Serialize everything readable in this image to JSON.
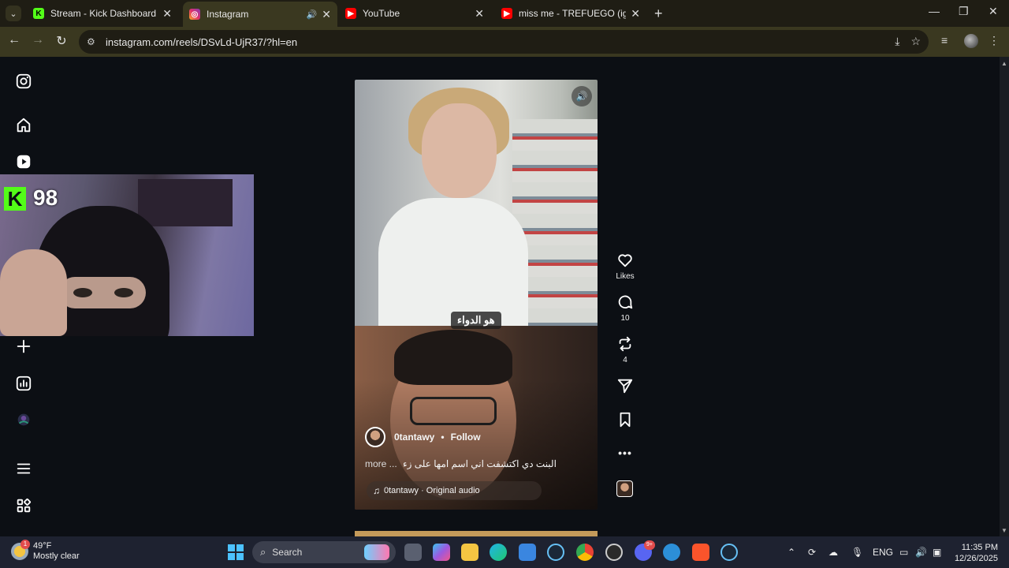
{
  "browser": {
    "tabs": [
      {
        "title": "Stream - Kick Dashboard",
        "active": false,
        "icon": "kick-icon",
        "favicon_color": "#53fc18"
      },
      {
        "title": "Instagram",
        "active": true,
        "icon": "instagram-icon",
        "audio": true
      },
      {
        "title": "YouTube",
        "active": false,
        "icon": "youtube-icon",
        "favicon_color": "#ff0000"
      },
      {
        "title": "miss me - TREFUEGO (ig: ismok",
        "active": false,
        "icon": "youtube-icon",
        "favicon_color": "#ff0000"
      }
    ],
    "url": "instagram.com/reels/DSvLd-UjR37/?hl=en"
  },
  "webcam": {
    "channel_badge": "K",
    "overlay_number": "98"
  },
  "reel": {
    "subtitle": "هو الدواء",
    "author": "0tantawy",
    "separator": "•",
    "follow_label": "Follow",
    "description": "البنت دي اكتشفت اني اسم امها على زء",
    "more_label": "more ...",
    "audio": "0tantawy · Original audio",
    "actions": {
      "likes_label": "Likes",
      "comments_count": "10",
      "reposts_count": "4",
      "more_icon": "•••"
    }
  },
  "taskbar": {
    "weather_temp": "49°F",
    "weather_desc": "Mostly clear",
    "weather_badge": "1",
    "search_label": "Search",
    "discord_badge": "9+",
    "language": "ENG",
    "time": "11:35 PM",
    "date": "12/26/2025"
  },
  "colors": {
    "browser_tab_bg": "#1f1d14",
    "browser_active": "#3a3820",
    "page_bg": "#0c0f14",
    "kick_green": "#53fc18",
    "taskbar_bg": "#1e2230"
  }
}
